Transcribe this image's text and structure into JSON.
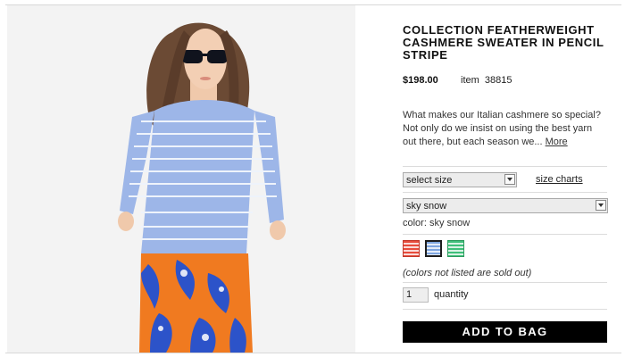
{
  "product": {
    "title": "COLLECTION FEATHERWEIGHT CASHMERE SWEATER IN PENCIL STRIPE",
    "price": "$198.00",
    "item_label": "item",
    "item_number": "38815",
    "description": "What makes our Italian cashmere so special? Not only do we insist on using the best yarn out there, but each season we...",
    "more_link": "More"
  },
  "size": {
    "selected": "select size",
    "charts_link": "size charts"
  },
  "color": {
    "selected": "sky snow",
    "label": "color: sky snow",
    "swatches": [
      {
        "name": "red-stripe",
        "color": "#e74c3c"
      },
      {
        "name": "sky-snow",
        "color": "#7fa6e0"
      },
      {
        "name": "green-stripe",
        "color": "#3fbf7a"
      }
    ]
  },
  "sold_out_note": "(colors not listed are sold out)",
  "quantity": {
    "value": "1",
    "label": "quantity"
  },
  "add_to_bag": "ADD TO BAG"
}
